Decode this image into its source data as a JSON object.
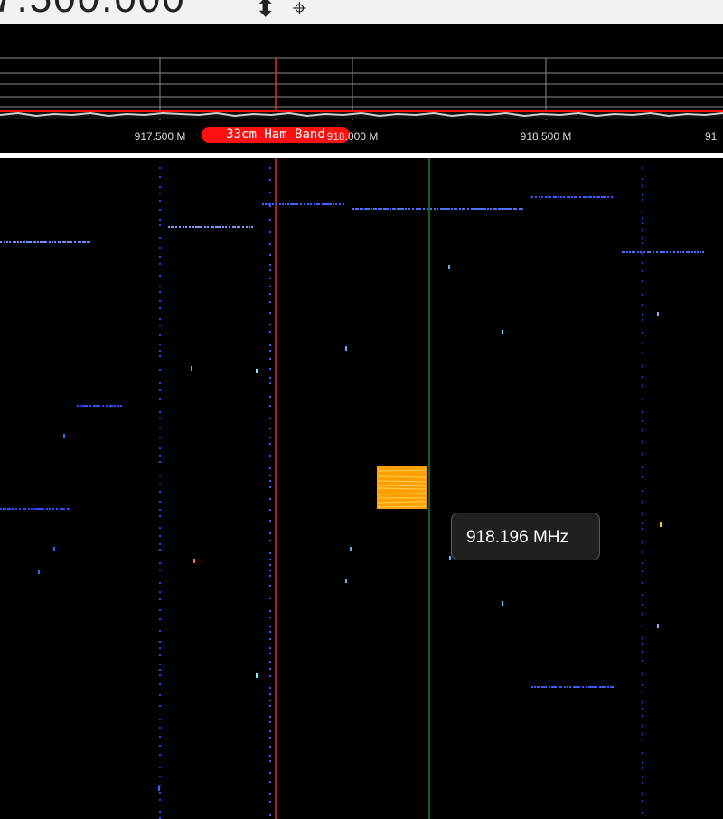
{
  "header": {
    "frequency_display": "7.500.000",
    "icons": [
      "swap-icon",
      "pin-icon"
    ]
  },
  "spectrum": {
    "band_label": "33cm Ham Band",
    "ticks": [
      "917.500 M",
      "918.000 M",
      "918.500 M",
      "91"
    ]
  },
  "tooltip": {
    "text": "918.196 MHz"
  },
  "colors": {
    "top_bar": "#f2f2f2",
    "center_marker": "#e03030",
    "tuning_marker": "#20c040",
    "band_label": "#ff1010",
    "signal": "#ffa000",
    "waterfall_dots": "#3060ff"
  }
}
